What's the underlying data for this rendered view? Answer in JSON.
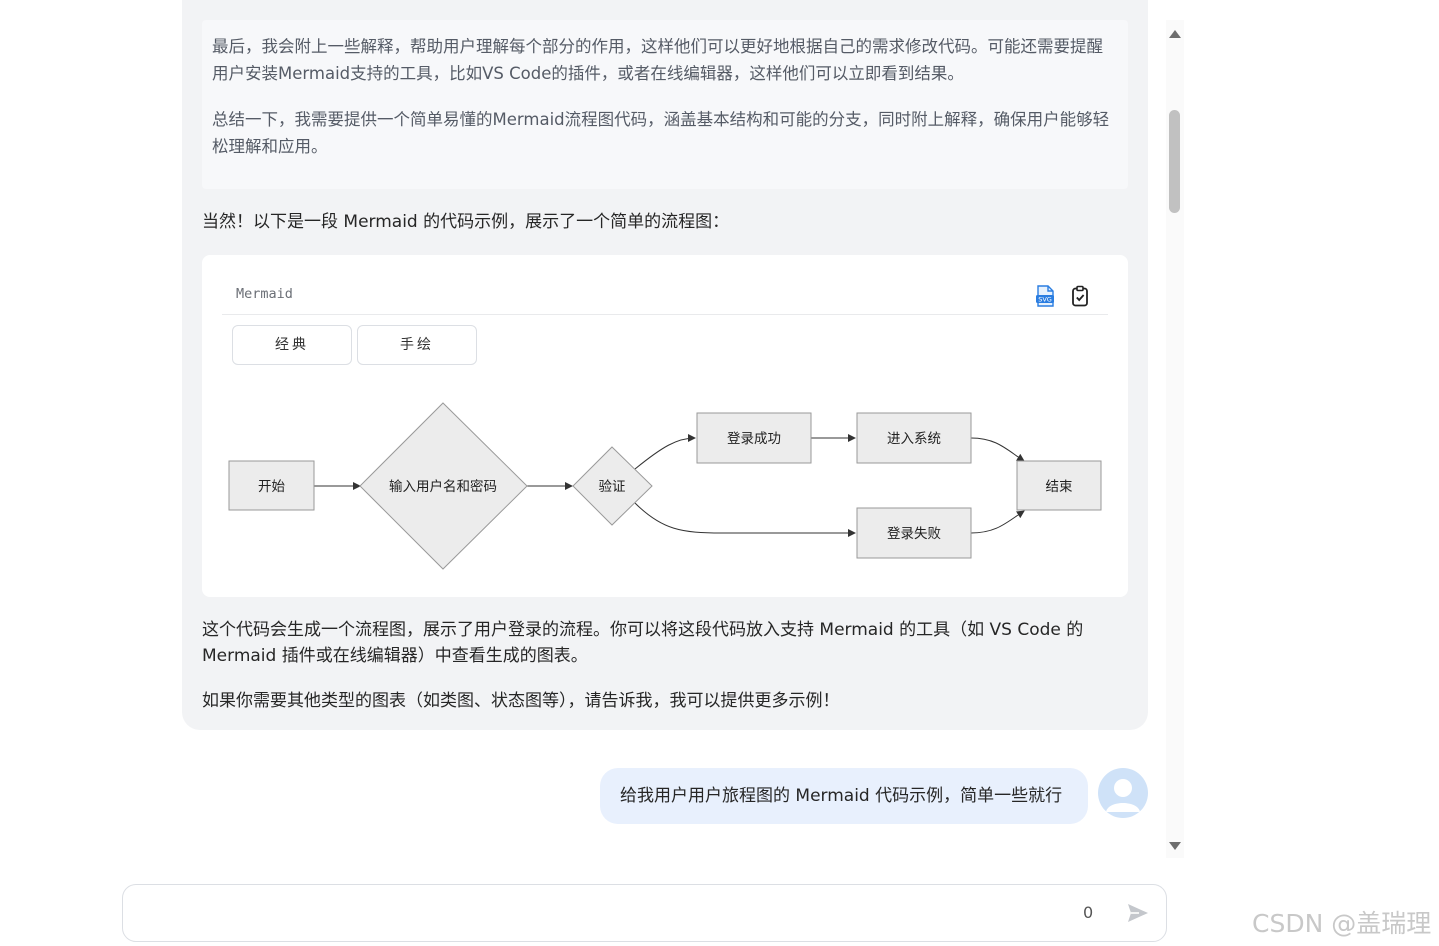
{
  "reasoning": {
    "paragraphs": [
      "最后，我会附上一些解释，帮助用户理解每个部分的作用，这样他们可以更好地根据自己的需求修改代码。可能还需要提醒用户安装Mermaid支持的工具，比如VS Code的插件，或者在线编辑器，这样他们可以立即看到结果。",
      "总结一下，我需要提供一个简单易懂的Mermaid流程图代码，涵盖基本结构和可能的分支，同时附上解释，确保用户能够轻松理解和应用。"
    ]
  },
  "answer": {
    "intro": "当然！以下是一段 Mermaid 的代码示例，展示了一个简单的流程图：",
    "outro": [
      "这个代码会生成一个流程图，展示了用户登录的流程。你可以将这段代码放入支持 Mermaid 的工具（如 VS Code 的 Mermaid 插件或在线编辑器）中查看生成的图表。",
      "如果你需要其他类型的图表（如类图、状态图等），请告诉我，我可以提供更多示例！"
    ]
  },
  "code_block": {
    "language": "Mermaid",
    "tabs": [
      "经典",
      "手绘"
    ],
    "svg_icon": "svg-download-icon",
    "copy_icon": "clipboard-check-icon"
  },
  "flowchart": {
    "nodes": {
      "start": "开始",
      "input": "输入用户名和密码",
      "verify": "验证",
      "success": "登录成功",
      "enter": "进入系统",
      "fail": "登录失败",
      "end": "结束"
    }
  },
  "user_message": "给我用户用户旅程图的 Mermaid 代码示例，简单一些就行",
  "composer": {
    "char_count": "0",
    "send_icon": "send-icon"
  },
  "watermark": "CSDN @盖瑞理",
  "colors": {
    "assistant_bg": "#f2f3f5",
    "user_bubble": "#e8f0fd",
    "node_fill": "#ececec"
  }
}
